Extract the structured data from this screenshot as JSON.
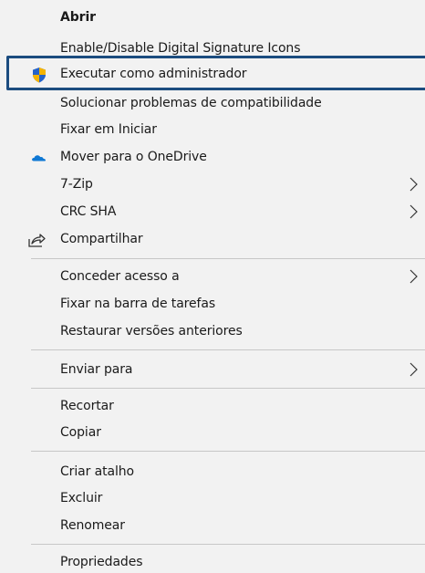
{
  "context_menu": {
    "items": [
      {
        "label": "Abrir"
      },
      {
        "label": "Enable/Disable Digital Signature Icons"
      },
      {
        "label": "Executar como administrador",
        "icon": "uac-shield-icon"
      },
      {
        "label": "Solucionar problemas de compatibilidade"
      },
      {
        "label": "Fixar em Iniciar"
      },
      {
        "label": "Mover para o OneDrive",
        "icon": "onedrive-cloud-icon"
      },
      {
        "label": "7-Zip",
        "submenu": true
      },
      {
        "label": "CRC SHA",
        "submenu": true
      },
      {
        "label": "Compartilhar",
        "icon": "share-icon"
      },
      {
        "label": "Conceder acesso a",
        "submenu": true
      },
      {
        "label": "Fixar na barra de tarefas"
      },
      {
        "label": "Restaurar versões anteriores"
      },
      {
        "label": "Enviar para",
        "submenu": true
      },
      {
        "label": "Recortar"
      },
      {
        "label": "Copiar"
      },
      {
        "label": "Criar atalho"
      },
      {
        "label": "Excluir"
      },
      {
        "label": "Renomear"
      },
      {
        "label": "Propriedades"
      }
    ]
  },
  "colors": {
    "menu_background": "#f2f2f2",
    "separator": "#c7c7c7",
    "highlight_border": "#1b4c7f",
    "onedrive_blue": "#0f78d4",
    "shield_blue": "#2563c9",
    "shield_gold": "#f5b400"
  }
}
